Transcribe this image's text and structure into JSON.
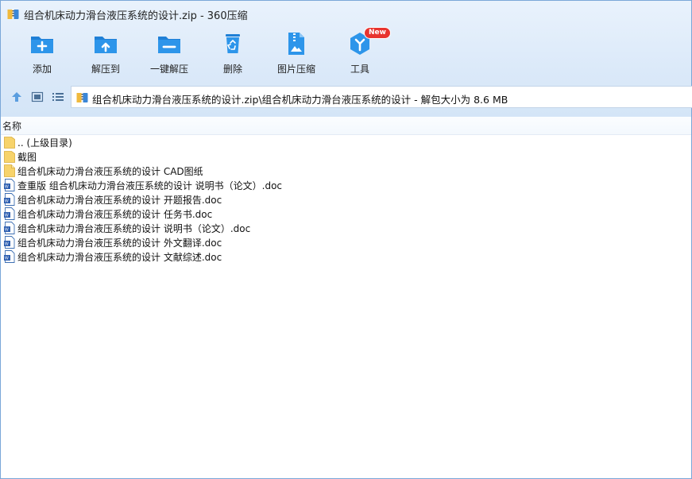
{
  "window": {
    "title": "组合机床动力滑台液压系统的设计.zip - 360压缩"
  },
  "toolbar": {
    "buttons": [
      {
        "id": "add",
        "label": "添加",
        "icon": "folder-add-icon"
      },
      {
        "id": "extract",
        "label": "解压到",
        "icon": "folder-extract-icon"
      },
      {
        "id": "one-click",
        "label": "一键解压",
        "icon": "folder-oneclick-icon"
      },
      {
        "id": "delete",
        "label": "删除",
        "icon": "recycle-bin-icon"
      },
      {
        "id": "image-compress",
        "label": "图片压缩",
        "icon": "image-compress-icon"
      },
      {
        "id": "tools",
        "label": "工具",
        "icon": "tools-icon",
        "badge": "New"
      }
    ]
  },
  "navbar": {
    "path": "组合机床动力滑台液压系统的设计.zip\\组合机床动力滑台液压系统的设计 - 解包大小为 8.6 MB"
  },
  "list": {
    "column_name": "名称",
    "items": [
      {
        "name": ".. (上级目录)",
        "type": "folder"
      },
      {
        "name": "截图",
        "type": "folder"
      },
      {
        "name": "组合机床动力滑台液压系统的设计 CAD图纸",
        "type": "folder-file"
      },
      {
        "name": "查重版 组合机床动力滑台液压系统的设计 说明书（论文）.doc",
        "type": "doc"
      },
      {
        "name": "组合机床动力滑台液压系统的设计 开题报告.doc",
        "type": "doc"
      },
      {
        "name": "组合机床动力滑台液压系统的设计 任务书.doc",
        "type": "doc"
      },
      {
        "name": "组合机床动力滑台液压系统的设计 说明书（论文）.doc",
        "type": "doc"
      },
      {
        "name": "组合机床动力滑台液压系统的设计 外文翻译.doc",
        "type": "doc"
      },
      {
        "name": "组合机床动力滑台液压系统的设计 文献综述.doc",
        "type": "doc"
      }
    ]
  },
  "colors": {
    "accent": "#2a8ee0",
    "badge": "#e8342f",
    "folder": "#f7d36b"
  }
}
